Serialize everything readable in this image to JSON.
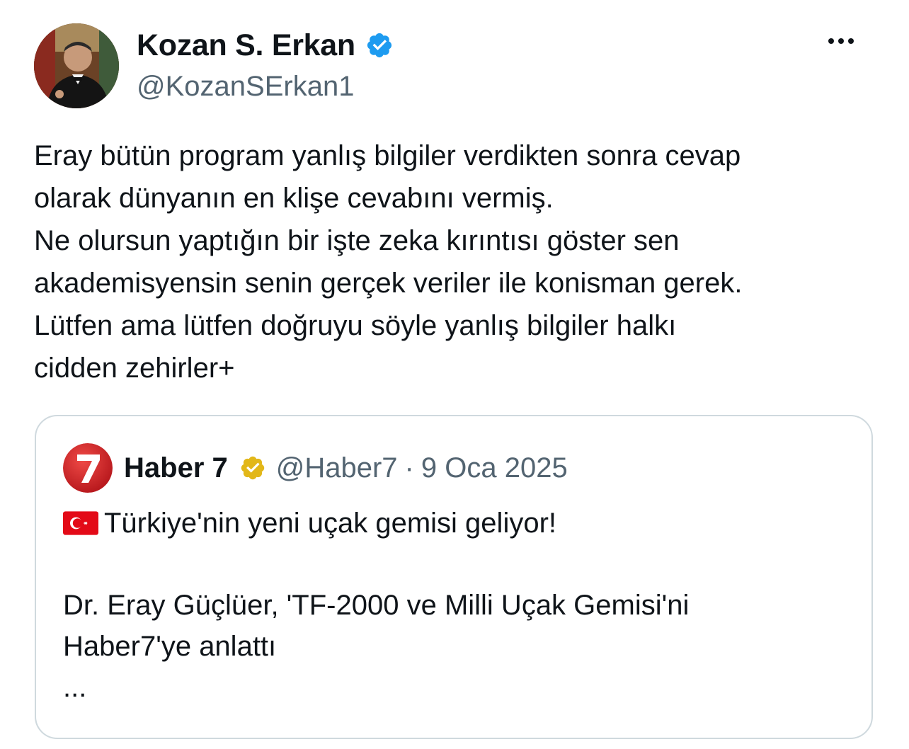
{
  "author": {
    "display_name": "Kozan S. Erkan",
    "handle": "@KozanSErkan1",
    "avatar_icon": "profile-photo",
    "verified_icon": "verified-badge-blue-icon"
  },
  "menu": {
    "more_icon": "more-horizontal-icon"
  },
  "tweet": {
    "lines": [
      "Eray bütün program yanlış bilgiler verdikten sonra cevap",
      "olarak dünyanın en klişe cevabını vermiş.",
      "Ne olursun yaptığın bir işte zeka kırıntısı göster sen",
      "akademisyensin senin gerçek veriler ile konisman gerek.",
      "Lütfen ama lütfen doğruyu söyle yanlış bilgiler halkı",
      "cidden zehirler+"
    ]
  },
  "quote": {
    "display_name": "Haber 7",
    "handle": "@Haber7",
    "separator": "·",
    "date": "9 Oca 2025",
    "avatar_icon": "haber7-logo",
    "verified_icon": "verified-badge-gold-icon",
    "line1_flag_icon": "turkey-flag-icon",
    "line1": "Türkiye'nin yeni uçak gemisi geliyor!",
    "line2": "Dr. Eray Güçlüer, 'TF-2000 ve Milli Uçak Gemisi'ni",
    "line3": "Haber7'ye anlattı",
    "line4": "..."
  },
  "colors": {
    "text_primary": "#0f1419",
    "text_secondary": "#536471",
    "verified_blue": "#1d9bf0",
    "verified_gold": "#e2b719",
    "card_border": "#cfd9de",
    "haber7_red": "#d7262a"
  }
}
